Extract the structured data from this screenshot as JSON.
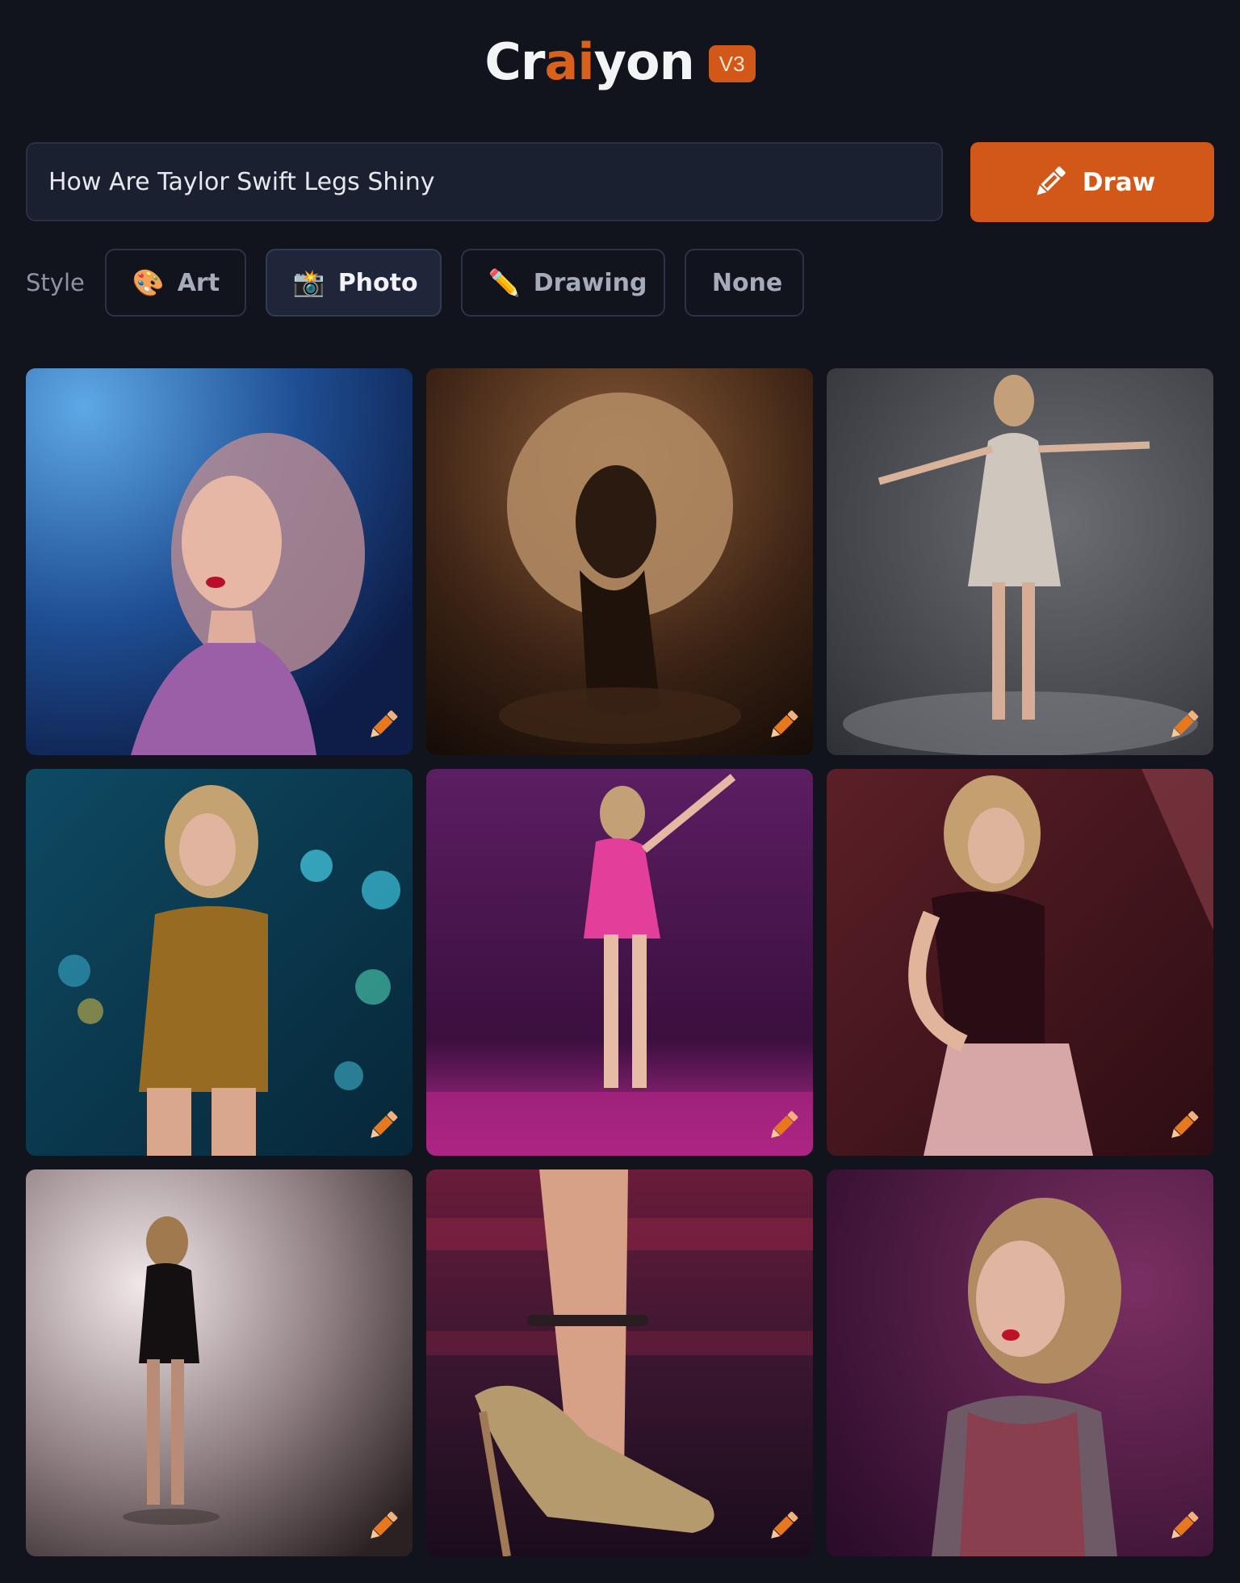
{
  "header": {
    "logo_prefix": "Cr",
    "logo_accent": "ai",
    "logo_suffix": "yon",
    "version": "V3"
  },
  "prompt": {
    "value": "How Are Taylor Swift Legs Shiny",
    "draw_label": "Draw",
    "draw_icon": "pencil-icon"
  },
  "style": {
    "label": "Style",
    "options": [
      {
        "label": "Art",
        "emoji": "🎨",
        "icon": "palette-icon"
      },
      {
        "label": "Photo",
        "emoji": "📸",
        "icon": "camera-flash-icon",
        "selected": true
      },
      {
        "label": "Drawing",
        "emoji": "✏️",
        "icon": "pencil-icon"
      },
      {
        "label": "None"
      }
    ]
  },
  "results": {
    "count": 9,
    "overlay_icon": "edit-pencil-icon"
  },
  "colors": {
    "background": "#11141d",
    "accent": "#d2581a",
    "input_bg": "#1b2030"
  }
}
